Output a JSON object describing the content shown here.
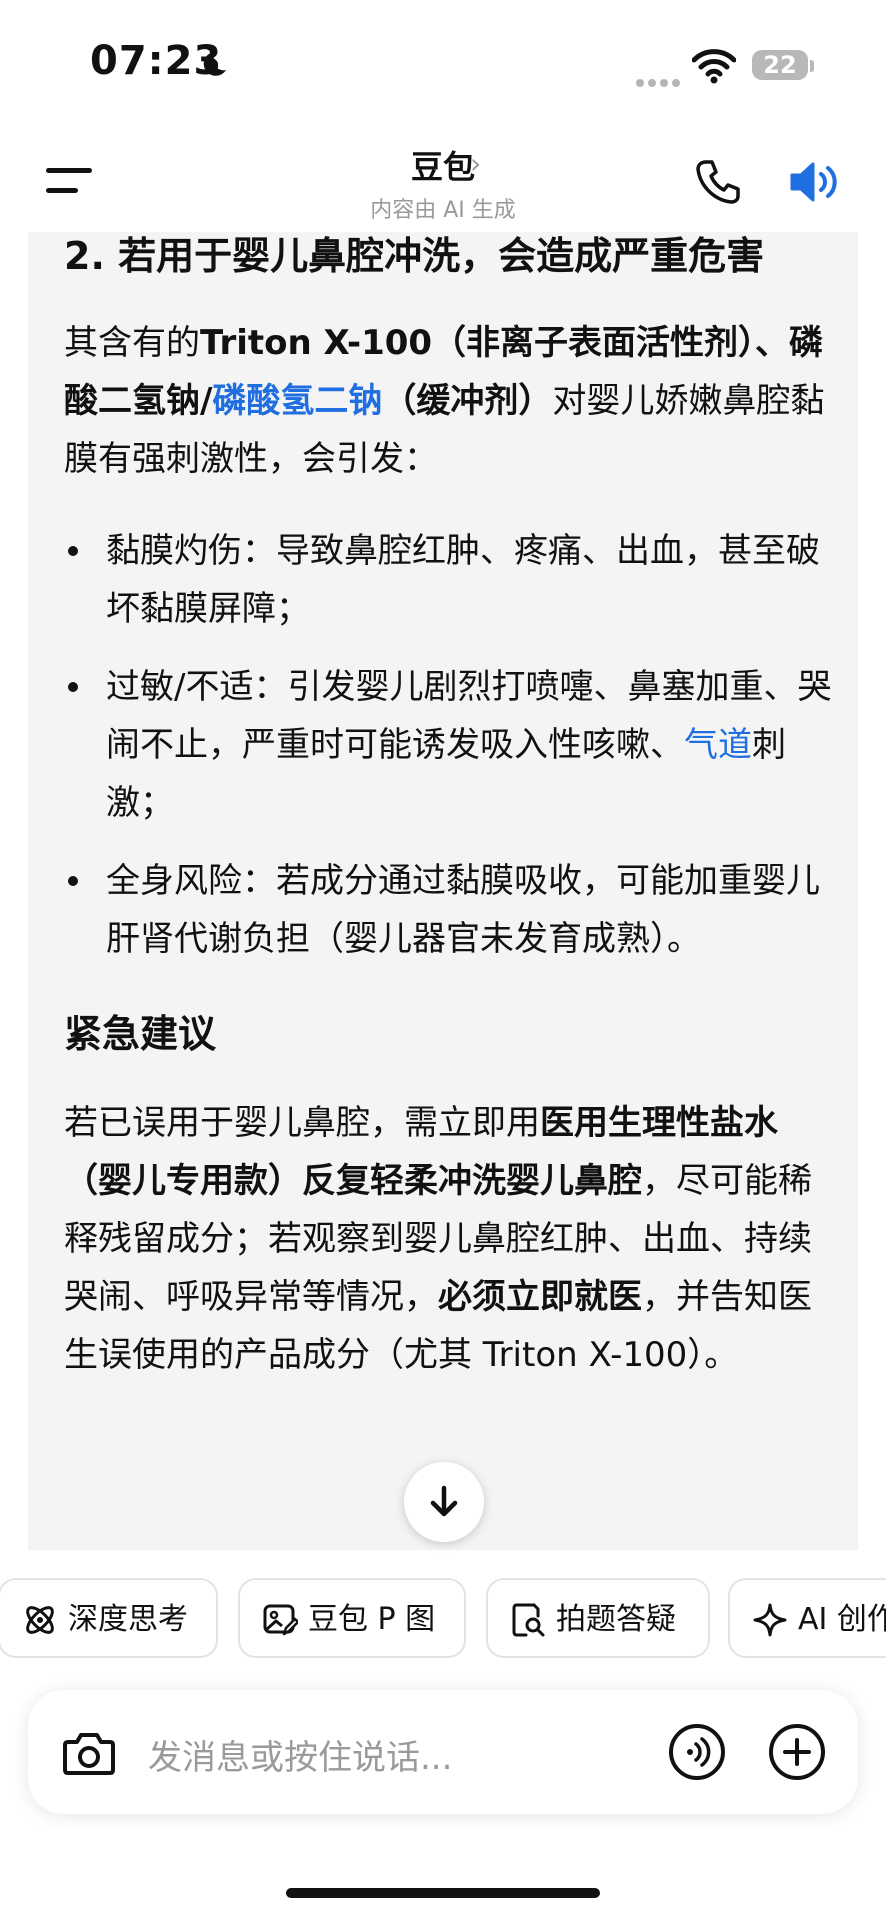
{
  "status_bar": {
    "time": "07:23",
    "battery": "22"
  },
  "header": {
    "title": "豆包",
    "subtitle": "内容由 AI 生成"
  },
  "message": {
    "heading": "2. 若用于婴儿鼻腔冲洗，会造成严重危害",
    "intro": {
      "t1": "其含有的",
      "b1": "Triton X-100（非离子表面活性剂）、磷酸二氢钠/",
      "link": "磷酸氢二钠",
      "b2": "（缓冲剂）",
      "t2": "对婴儿娇嫩鼻腔黏膜有强刺激性，会引发："
    },
    "bullets": [
      {
        "text": "黏膜灼伤：导致鼻腔红肿、疼痛、出血，甚至破坏黏膜屏障；"
      },
      {
        "pre": "过敏/不适：引发婴儿剧烈打喷嚏、鼻塞加重、哭闹不止，严重时可能诱发吸入性咳嗽、",
        "link": "气道",
        "post": "刺激；"
      },
      {
        "text": "全身风险：若成分通过黏膜吸收，可能加重婴儿肝肾代谢负担（婴儿器官未发育成熟）。"
      }
    ],
    "urgent_heading": "紧急建议",
    "urgent": {
      "t1": "若已误用于婴儿鼻腔，需立即用",
      "b1": "医用生理性盐水（婴儿专用款）反复轻柔冲洗婴儿鼻腔",
      "t2": "，尽可能稀释残留成分；若观察到婴儿鼻腔红肿、出血、持续哭闹、呼吸异常等情况，",
      "b2": "必须立即就医",
      "t3": "，并告知医生误使用的产品成分（尤其 Triton X-100）。"
    }
  },
  "chips": [
    {
      "label": "深度思考",
      "icon": "atom-icon"
    },
    {
      "label": "豆包 P 图",
      "icon": "image-edit-icon"
    },
    {
      "label": "拍题答疑",
      "icon": "search-doc-icon"
    },
    {
      "label": "AI 创作",
      "icon": "sparkle-icon"
    }
  ],
  "input": {
    "placeholder": "发消息或按住说话..."
  },
  "colors": {
    "link": "#1f6fe0",
    "accent": "#1f6fe0",
    "card_bg": "#f4f4f5"
  }
}
